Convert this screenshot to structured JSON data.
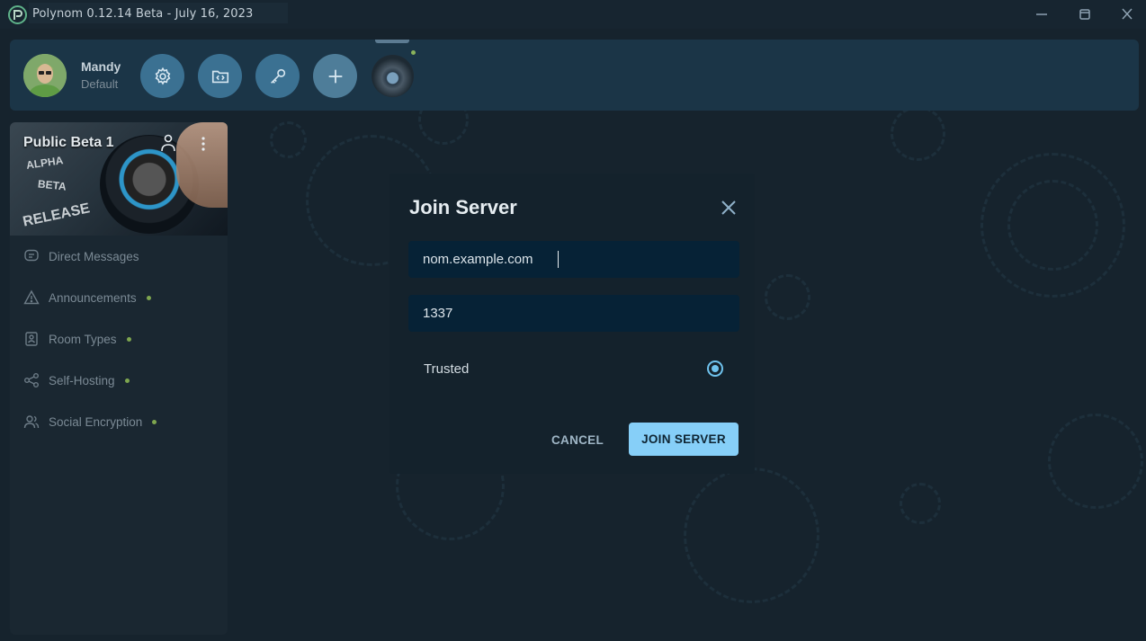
{
  "window": {
    "title": "Polynom 0.12.14 Beta  -  July 16, 2023",
    "controls": [
      "minimize-icon",
      "maximize-icon",
      "close-icon"
    ]
  },
  "user": {
    "name": "Mandy",
    "status": "Default"
  },
  "toolbar": {
    "buttons": [
      "settings-icon",
      "code-folder-icon",
      "key-icon",
      "plus-icon"
    ]
  },
  "server": {
    "name": "Public Beta 1",
    "banner_labels": [
      "ALPHA",
      "BETA",
      "RELEASE"
    ],
    "channels": [
      {
        "label": "Direct Messages",
        "icon": "chat-icon",
        "unread": false
      },
      {
        "label": "Announcements",
        "icon": "warning-icon",
        "unread": true
      },
      {
        "label": "Room Types",
        "icon": "room-icon",
        "unread": true
      },
      {
        "label": "Self-Hosting",
        "icon": "share-icon",
        "unread": true
      },
      {
        "label": "Social Encryption",
        "icon": "people-icon",
        "unread": true
      }
    ]
  },
  "dialog": {
    "title": "Join Server",
    "host_value": "nom.example.com",
    "port_value": "1337",
    "trusted_label": "Trusted",
    "trusted_checked": true,
    "cancel_label": "CANCEL",
    "join_label": "JOIN SERVER"
  },
  "colors": {
    "accent": "#86cff8",
    "unread_dot": "#7ea64f",
    "field_bg": "#062236",
    "dialog_bg": "#14222c"
  }
}
